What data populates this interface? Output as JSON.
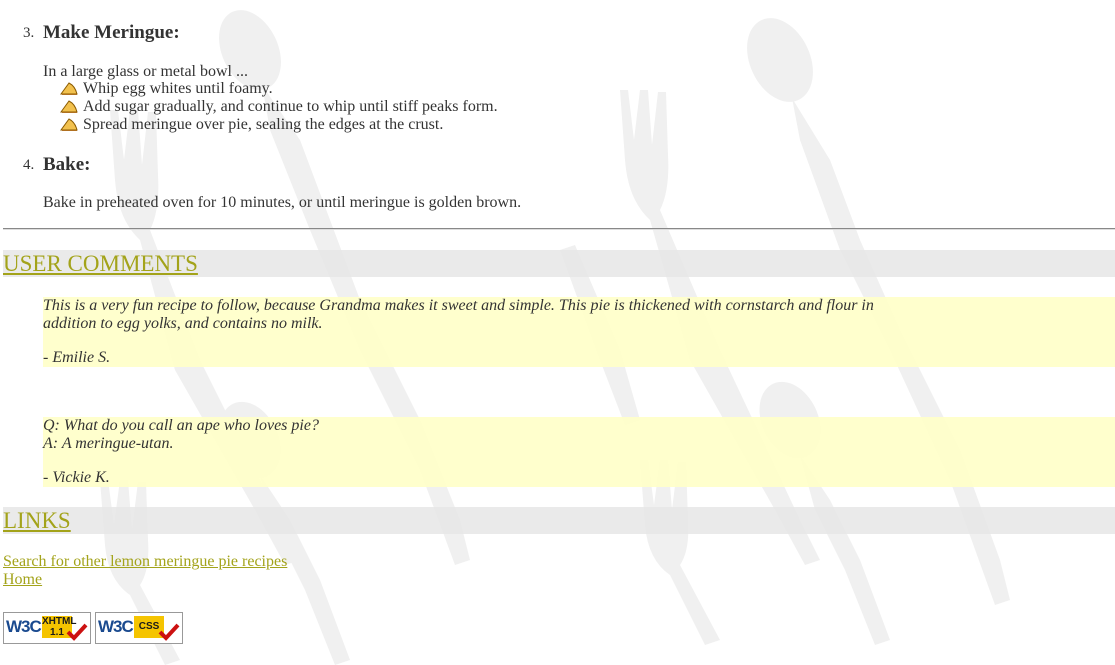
{
  "steps": [
    {
      "number": "3.",
      "title": "Make Meringue:",
      "intro": "In a large glass or metal bowl ...",
      "bullets": [
        "Whip egg whites until foamy.",
        "Add sugar gradually, and continue to whip until stiff peaks form.",
        "Spread meringue over pie, sealing the edges at the crust."
      ]
    },
    {
      "number": "4.",
      "title": "Bake:",
      "intro": "Bake in preheated oven for 10 minutes, or until meringue is golden brown."
    }
  ],
  "comments_section": {
    "heading": "USER COMMENTS",
    "comments": [
      {
        "line1": "This is a very fun recipe to follow, because Grandma makes it sweet and simple. This pie is thickened with cornstarch and flour in",
        "line2": "addition to egg yolks, and contains no milk.",
        "author": "- Emilie S."
      },
      {
        "line1": "Q: What do you call an ape who loves pie?",
        "line2": "A: A meringue-utan.",
        "author": "- Vickie K."
      }
    ]
  },
  "links_section": {
    "heading": "LINKS",
    "links": [
      "Search for other lemon meringue pie recipes",
      "Home"
    ]
  },
  "badges": [
    {
      "logo": "W3C",
      "label_top": "XHTML",
      "label_bottom": "1.1"
    },
    {
      "logo": "W3C",
      "label_top": "CSS",
      "label_bottom": ""
    }
  ],
  "colors": {
    "link": "#a3a31a",
    "comment_bg": "#ffffc8",
    "section_bar": "#e6e6e6",
    "text": "#333333"
  },
  "icons": {
    "bullet": "pie-slice-icon",
    "check": "checkmark-icon"
  }
}
